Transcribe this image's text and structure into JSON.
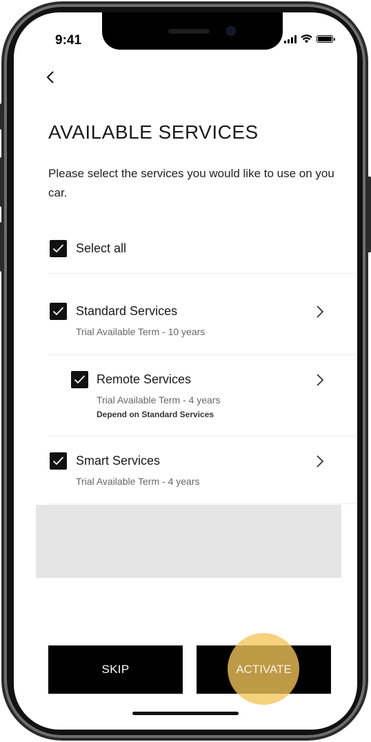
{
  "status_bar": {
    "time": "9:41"
  },
  "nav": {
    "back_icon": "chevron-left-icon"
  },
  "page": {
    "title": "AVAILABLE SERVICES",
    "description": "Please select the services you would like to use on you car."
  },
  "select_all": {
    "label": "Select all",
    "checked": true
  },
  "services": [
    {
      "name": "Standard Services",
      "term": "Trial Available Term - 10 years",
      "checked": true
    },
    {
      "name": "Remote Services",
      "term": "Trial Available Term - 4 years",
      "dependency": "Depend on Standard Services",
      "checked": true
    },
    {
      "name": "Smart Services",
      "term": "Trial Available Term - 4 years",
      "checked": true
    }
  ],
  "actions": {
    "skip_label": "SKIP",
    "activate_label": "ACTIVATE"
  },
  "colors": {
    "accent_tap": "#f4c45a",
    "button_bg": "#000000",
    "placeholder": "#e5e5e5"
  }
}
